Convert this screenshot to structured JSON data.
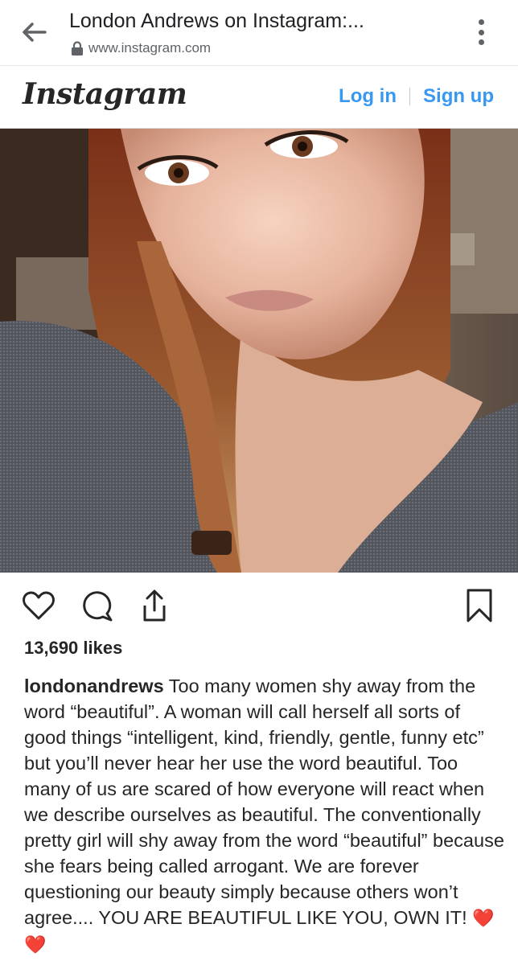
{
  "browser": {
    "title": "London Andrews on Instagram:...",
    "url": "www.instagram.com",
    "icons": {
      "back": "back-arrow-icon",
      "lock": "lock-icon",
      "menu": "more-vert-icon"
    }
  },
  "header": {
    "logo": "Instagram",
    "login": "Log in",
    "signup": "Sign up",
    "link_color": "#3897f0"
  },
  "post": {
    "likes": "13,690 likes",
    "username": "londonandrews",
    "caption": "Too many women shy away from the word “beautiful”. A woman will call herself all sorts of good things “intelligent, kind, friendly, gentle, funny etc” but you’ll never hear her use the word beautiful. Too many of us are scared of how everyone will react when we describe ourselves as beautiful. The conventionally pretty girl will shy away from the word “beautiful” because she fears being called arrogant. We are forever questioning our beauty simply because others won’t agree.... YOU ARE BEAUTIFUL LIKE YOU, OWN IT!",
    "caption_emoji": "❤️❤️",
    "icons": [
      "heart-icon",
      "comment-icon",
      "share-icon",
      "bookmark-icon"
    ]
  }
}
